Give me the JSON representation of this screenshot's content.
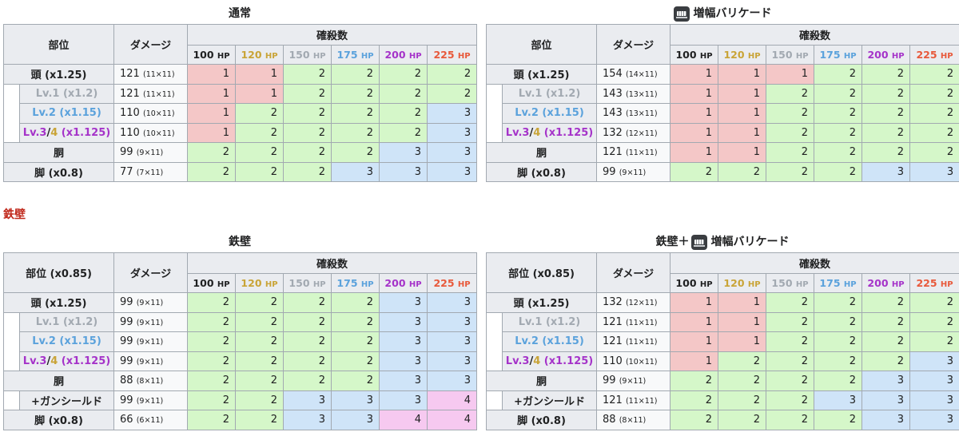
{
  "colors": {
    "hp100": "#202122",
    "hp120": "#c9a437",
    "hp150": "#a2a9b1",
    "hp175": "#5ba2dc",
    "hp200": "#a533c9",
    "hp225": "#e8593b",
    "kill1": "#f4c7c7",
    "kill2": "#d5f7c9",
    "kill3": "#cfe4f8",
    "kill4": "#f6c9f0",
    "section_title": "#c0281b"
  },
  "icon": "amped-barricade-icon",
  "headers": {
    "damage": "ダメージ",
    "shots": "確殺数",
    "hp_unit": "HP",
    "hp": [
      "100",
      "120",
      "150",
      "175",
      "200",
      "225"
    ]
  },
  "parts": {
    "head": "頭 (x1.25)",
    "lv1": "Lv.1 (x1.2)",
    "lv2": "Lv.2 (x1.15)",
    "lv3_a": "Lv.3",
    "slash": "/",
    "lv3_b": "4",
    "lv3_c": " (x1.125)",
    "body": "胴",
    "gunshield": "+ガンシールド",
    "leg": "脚 (x0.8)"
  },
  "section_label": "鉄壁",
  "tables": [
    {
      "caption": "通常",
      "part_header": "部位",
      "rows": [
        {
          "dmg": "121",
          "mult": "(11×11)",
          "vals": [
            "1",
            "1",
            "2",
            "2",
            "2",
            "2"
          ]
        },
        {
          "dmg": "121",
          "mult": "(11×11)",
          "vals": [
            "1",
            "1",
            "2",
            "2",
            "2",
            "2"
          ]
        },
        {
          "dmg": "110",
          "mult": "(10×11)",
          "vals": [
            "1",
            "2",
            "2",
            "2",
            "2",
            "3"
          ]
        },
        {
          "dmg": "110",
          "mult": "(10×11)",
          "vals": [
            "1",
            "2",
            "2",
            "2",
            "2",
            "3"
          ]
        },
        {
          "dmg": "99",
          "mult": "(9×11)",
          "vals": [
            "2",
            "2",
            "2",
            "2",
            "3",
            "3"
          ]
        },
        {
          "dmg": "77",
          "mult": "(7×11)",
          "vals": [
            "2",
            "2",
            "2",
            "3",
            "3",
            "3"
          ]
        }
      ]
    },
    {
      "caption": "増幅バリケード",
      "part_header": "部位",
      "rows": [
        {
          "dmg": "154",
          "mult": "(14×11)",
          "vals": [
            "1",
            "1",
            "1",
            "2",
            "2",
            "2"
          ]
        },
        {
          "dmg": "143",
          "mult": "(13×11)",
          "vals": [
            "1",
            "1",
            "2",
            "2",
            "2",
            "2"
          ]
        },
        {
          "dmg": "143",
          "mult": "(13×11)",
          "vals": [
            "1",
            "1",
            "2",
            "2",
            "2",
            "2"
          ]
        },
        {
          "dmg": "132",
          "mult": "(12×11)",
          "vals": [
            "1",
            "1",
            "2",
            "2",
            "2",
            "2"
          ]
        },
        {
          "dmg": "121",
          "mult": "(11×11)",
          "vals": [
            "1",
            "1",
            "2",
            "2",
            "2",
            "2"
          ]
        },
        {
          "dmg": "99",
          "mult": "(9×11)",
          "vals": [
            "2",
            "2",
            "2",
            "2",
            "3",
            "3"
          ]
        }
      ]
    },
    {
      "caption": "鉄壁",
      "part_header": "部位 (x0.85)",
      "rows": [
        {
          "dmg": "99",
          "mult": "(9×11)",
          "vals": [
            "2",
            "2",
            "2",
            "2",
            "3",
            "3"
          ]
        },
        {
          "dmg": "99",
          "mult": "(9×11)",
          "vals": [
            "2",
            "2",
            "2",
            "2",
            "3",
            "3"
          ]
        },
        {
          "dmg": "99",
          "mult": "(9×11)",
          "vals": [
            "2",
            "2",
            "2",
            "2",
            "3",
            "3"
          ]
        },
        {
          "dmg": "99",
          "mult": "(9×11)",
          "vals": [
            "2",
            "2",
            "2",
            "2",
            "3",
            "3"
          ]
        },
        {
          "dmg": "88",
          "mult": "(8×11)",
          "vals": [
            "2",
            "2",
            "2",
            "2",
            "3",
            "3"
          ]
        },
        {
          "dmg": "99",
          "mult": "(9×11)",
          "vals": [
            "2",
            "2",
            "3",
            "3",
            "3",
            "4"
          ]
        },
        {
          "dmg": "66",
          "mult": "(6×11)",
          "vals": [
            "2",
            "2",
            "3",
            "3",
            "4",
            "4"
          ]
        }
      ]
    },
    {
      "caption_a": "鉄壁＋",
      "caption_b": "増幅バリケード",
      "part_header": "部位 (x0.85)",
      "rows": [
        {
          "dmg": "132",
          "mult": "(12×11)",
          "vals": [
            "1",
            "1",
            "2",
            "2",
            "2",
            "2"
          ]
        },
        {
          "dmg": "121",
          "mult": "(11×11)",
          "vals": [
            "1",
            "1",
            "2",
            "2",
            "2",
            "2"
          ]
        },
        {
          "dmg": "121",
          "mult": "(11×11)",
          "vals": [
            "1",
            "1",
            "2",
            "2",
            "2",
            "2"
          ]
        },
        {
          "dmg": "110",
          "mult": "(10×11)",
          "vals": [
            "1",
            "2",
            "2",
            "2",
            "2",
            "3"
          ]
        },
        {
          "dmg": "99",
          "mult": "(9×11)",
          "vals": [
            "2",
            "2",
            "2",
            "2",
            "3",
            "3"
          ]
        },
        {
          "dmg": "121",
          "mult": "(11×11)",
          "vals": [
            "2",
            "2",
            "2",
            "3",
            "3",
            "3"
          ]
        },
        {
          "dmg": "88",
          "mult": "(8×11)",
          "vals": [
            "2",
            "2",
            "2",
            "2",
            "3",
            "3"
          ]
        }
      ]
    }
  ]
}
